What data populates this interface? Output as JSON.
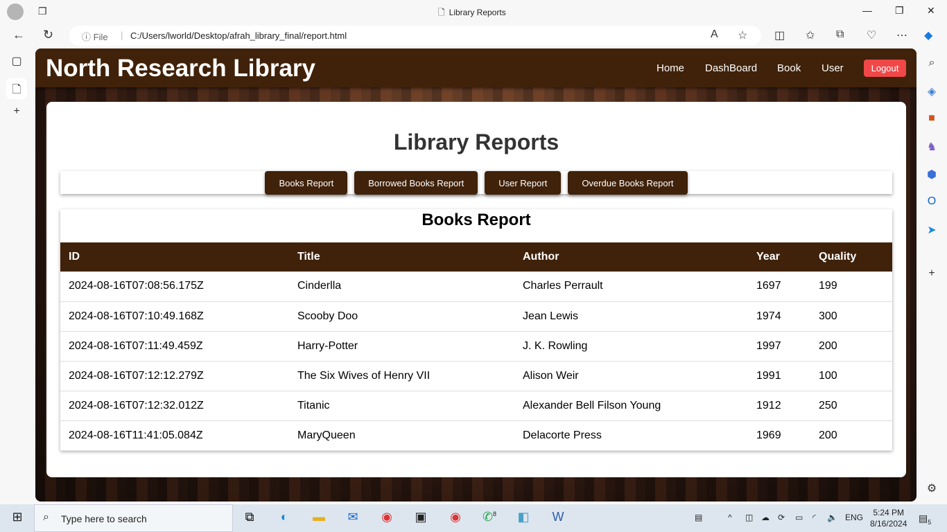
{
  "browser": {
    "tab_title": "Library Reports",
    "url_scheme": "File",
    "url": "C:/Users/lworld/Desktop/afrah_library_final/report.html"
  },
  "navbar": {
    "brand": "North Research Library",
    "links": [
      "Home",
      "DashBoard",
      "Book",
      "User"
    ],
    "logout": "Logout"
  },
  "page": {
    "heading": "Library Reports",
    "report_buttons": [
      "Books Report",
      "Borrowed Books Report",
      "User Report",
      "Overdue Books Report"
    ]
  },
  "report": {
    "title": "Books Report",
    "columns": [
      "ID",
      "Title",
      "Author",
      "Year",
      "Quality"
    ],
    "rows": [
      [
        "2024-08-16T07:08:56.175Z",
        "Cinderlla",
        "Charles Perrault",
        "1697",
        "199"
      ],
      [
        "2024-08-16T07:10:49.168Z",
        "Scooby Doo",
        "Jean Lewis",
        "1974",
        "300"
      ],
      [
        "2024-08-16T07:11:49.459Z",
        "Harry-Potter",
        "J. K. Rowling",
        "1997",
        "200"
      ],
      [
        "2024-08-16T07:12:12.279Z",
        "The Six Wives of Henry VII",
        "Alison Weir",
        "1991",
        "100"
      ],
      [
        "2024-08-16T07:12:32.012Z",
        "Titanic",
        "Alexander Bell Filson Young",
        "1912",
        "250"
      ],
      [
        "2024-08-16T11:41:05.084Z",
        "MaryQueen",
        "Delacorte Press",
        "1969",
        "200"
      ]
    ]
  },
  "colors": {
    "brand": "#40220a",
    "logout": "#f04848"
  },
  "taskbar": {
    "search_placeholder": "Type here to search",
    "language": "ENG",
    "time": "5:24 PM",
    "date": "8/16/2024",
    "whatsapp_badge": "8",
    "notifications": "5"
  }
}
